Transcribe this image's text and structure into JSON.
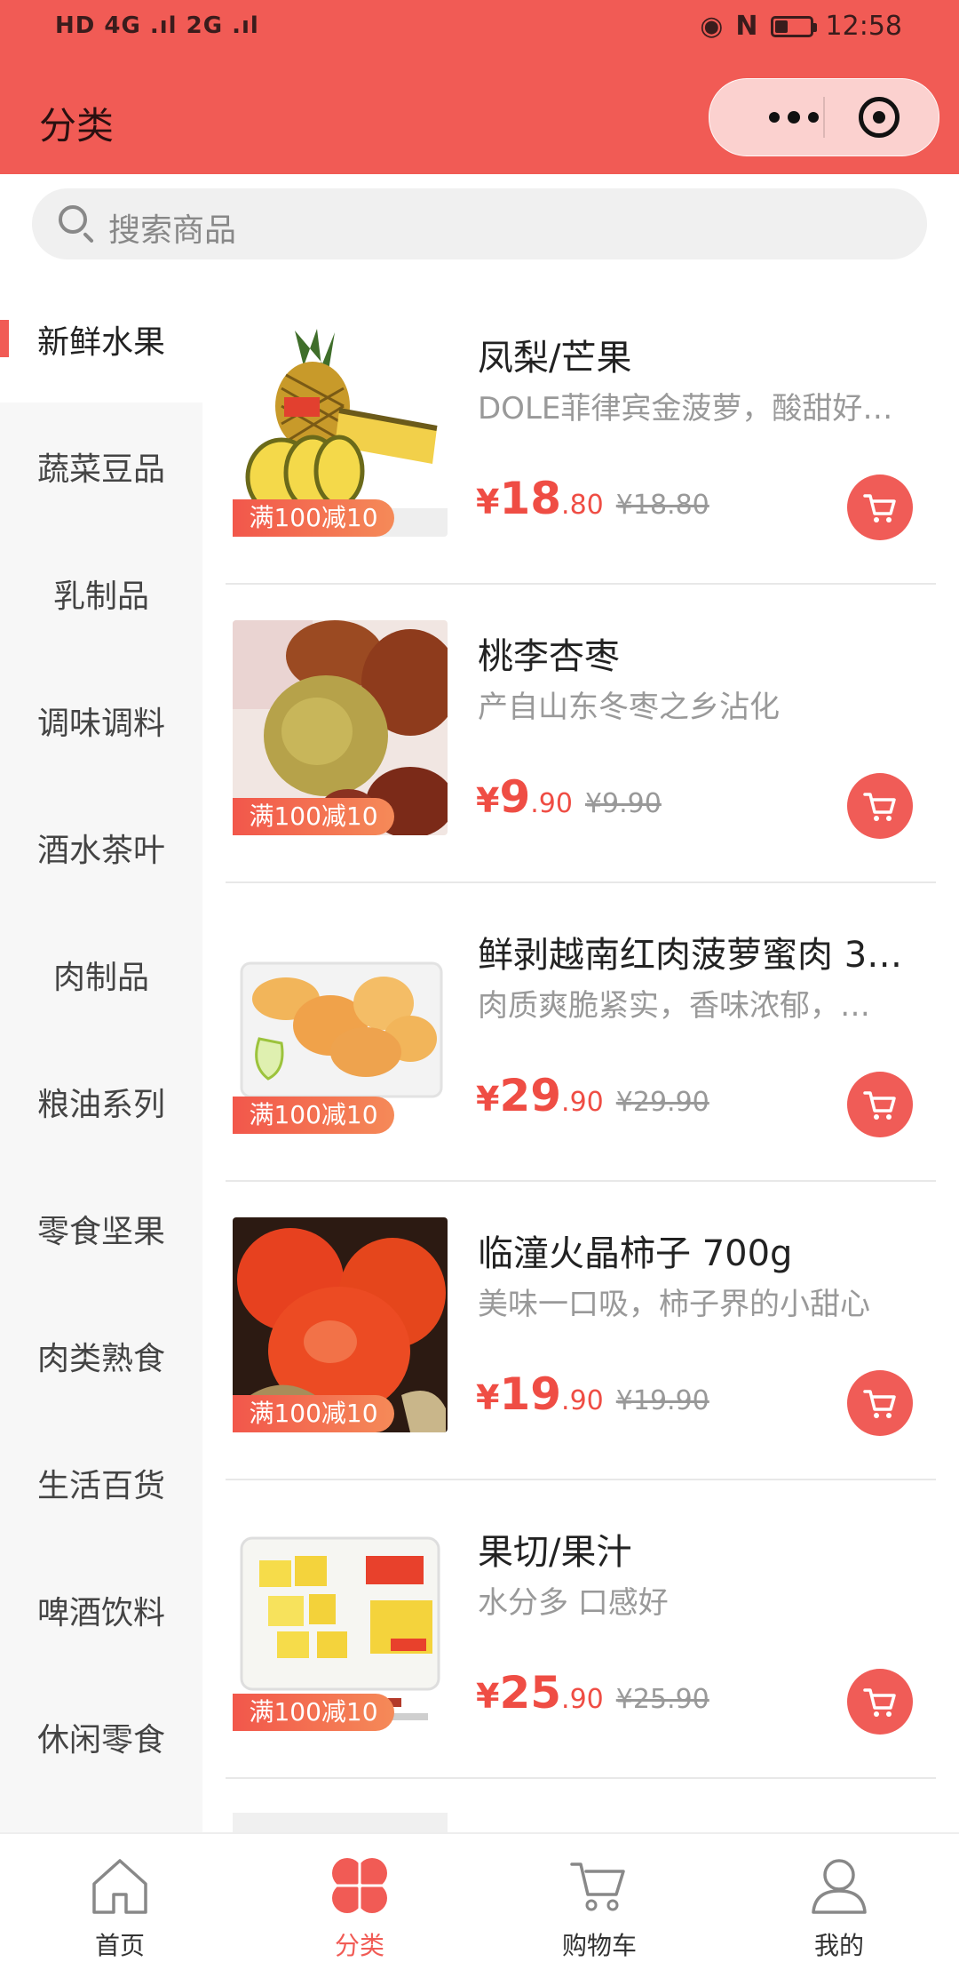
{
  "status_bar": {
    "left": "HD 4G .ıl 2G .ıl",
    "time": "12:58"
  },
  "header": {
    "title": "分类"
  },
  "search": {
    "placeholder": "搜索商品"
  },
  "colors": {
    "accent": "#f15b55",
    "price": "#ef4d44"
  },
  "categories": [
    {
      "label": "新鲜水果",
      "active": true
    },
    {
      "label": "蔬菜豆品"
    },
    {
      "label": "乳制品"
    },
    {
      "label": "调味调料"
    },
    {
      "label": "酒水茶叶"
    },
    {
      "label": "肉制品"
    },
    {
      "label": "粮油系列"
    },
    {
      "label": "零食坚果"
    },
    {
      "label": "肉类熟食"
    },
    {
      "label": "生活百货"
    },
    {
      "label": "啤酒饮料"
    },
    {
      "label": "休闲零食"
    }
  ],
  "products": [
    {
      "name": "凤梨/芒果",
      "desc": "DOLE菲律宾金菠萝，酸甜好…",
      "price_currency": "¥",
      "price_int": "18",
      "price_dec": ".80",
      "orig_price": "¥18.80",
      "tag": "满100减10"
    },
    {
      "name": "桃李杏枣",
      "desc": "产自山东冬枣之乡沾化",
      "price_currency": "¥",
      "price_int": "9",
      "price_dec": ".90",
      "orig_price": "¥9.90",
      "tag": "满100减10"
    },
    {
      "name": "鲜剥越南红肉菠萝蜜肉 3…",
      "desc": "肉质爽脆紧实，香味浓郁，…",
      "price_currency": "¥",
      "price_int": "29",
      "price_dec": ".90",
      "orig_price": "¥29.90",
      "tag": "满100减10"
    },
    {
      "name": "临潼火晶柿子 700g",
      "desc": "美味一口吸，柿子界的小甜心",
      "price_currency": "¥",
      "price_int": "19",
      "price_dec": ".90",
      "orig_price": "¥19.90",
      "tag": "满100减10"
    },
    {
      "name": "果切/果汁",
      "desc": "水分多 口感好",
      "price_currency": "¥",
      "price_int": "25",
      "price_dec": ".90",
      "orig_price": "¥25.90",
      "tag": "满100减10"
    }
  ],
  "tabbar": [
    {
      "label": "首页",
      "icon": "home-icon"
    },
    {
      "label": "分类",
      "icon": "category-icon",
      "active": true
    },
    {
      "label": "购物车",
      "icon": "cart-icon"
    },
    {
      "label": "我的",
      "icon": "user-icon"
    }
  ]
}
